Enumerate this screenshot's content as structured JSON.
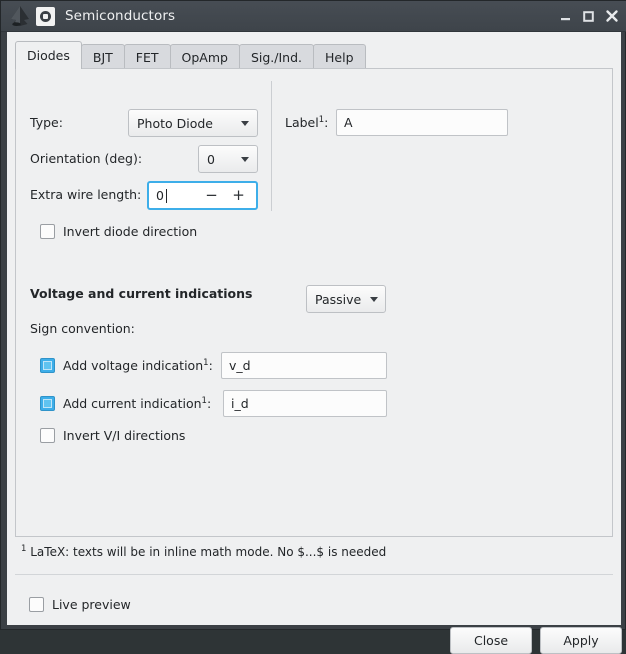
{
  "window": {
    "title": "Semiconductors",
    "logo_icon": "inkscape-logo-icon",
    "app_icon": "extension-icon",
    "minimize_icon": "minimize-icon",
    "maximize_icon": "maximize-icon",
    "close_icon": "close-icon"
  },
  "tabs": [
    {
      "label": "Diodes",
      "active": true
    },
    {
      "label": "BJT",
      "active": false
    },
    {
      "label": "FET",
      "active": false
    },
    {
      "label": "OpAmp",
      "active": false
    },
    {
      "label": "Sig./Ind.",
      "active": false
    },
    {
      "label": "Help",
      "active": false
    }
  ],
  "form": {
    "type_label": "Type:",
    "type_value": "Photo Diode",
    "orientation_label": "Orientation (deg):",
    "orientation_value": "0",
    "extra_wire_label": "Extra wire length:",
    "extra_wire_value": "0",
    "spin_minus": "−",
    "spin_plus": "+",
    "invert_diode_label": "Invert diode direction",
    "invert_diode_checked": false,
    "label_field_label": "Label",
    "label_field_sup": "1",
    "label_field_colon": ":",
    "label_field_value": "A"
  },
  "vi_section": {
    "heading": "Voltage and current indications",
    "sign_convention_label": "Sign convention:",
    "sign_convention_value": "Passive",
    "add_voltage_label": "Add voltage indication",
    "add_voltage_sup": "1",
    "add_voltage_colon": ":",
    "add_voltage_checked": true,
    "add_voltage_value": "v_d",
    "add_current_label": "Add current indication",
    "add_current_sup": "1",
    "add_current_colon": ":",
    "add_current_checked": true,
    "add_current_value": "i_d",
    "invert_vi_label": "Invert V/I directions",
    "invert_vi_checked": false
  },
  "footnote": {
    "marker": "1",
    "text": " LaTeX: texts will be in inline math mode. No $...$ is needed"
  },
  "bottom": {
    "live_preview_label": "Live preview",
    "live_preview_checked": false,
    "close_label": "Close",
    "apply_label": "Apply"
  },
  "colors": {
    "titlebar": "#3e444a",
    "dialog_bg": "#eff0f1",
    "accent": "#3daee9",
    "text": "#232629",
    "border": "#c3c6ca"
  }
}
